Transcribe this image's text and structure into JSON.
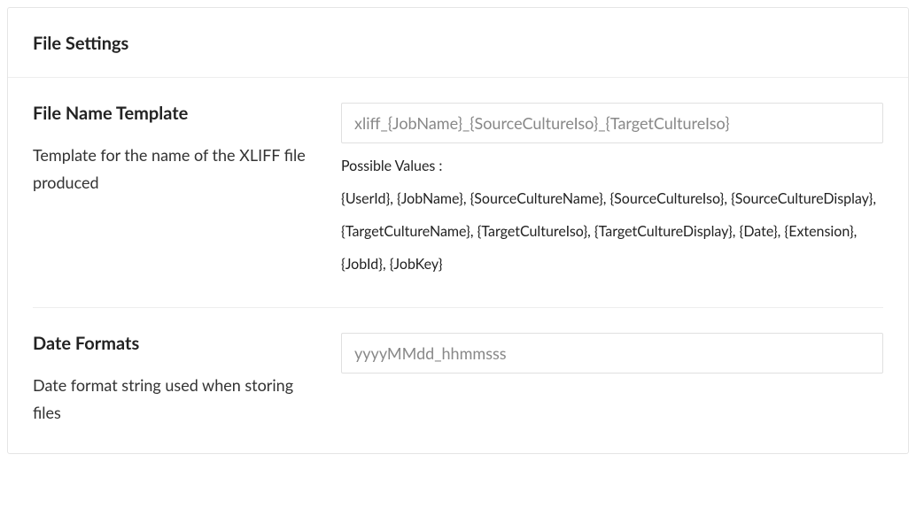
{
  "panel": {
    "title": "File Settings"
  },
  "settings": {
    "fileNameTemplate": {
      "label": "File Name Template",
      "description": "Template for the name of the XLIFF file produced",
      "value": "xliff_{JobName}_{SourceCultureIso}_{TargetCultureIso}",
      "hintLabel": "Possible Values :",
      "hintValues": "{UserId}, {JobName}, {SourceCultureName}, {SourceCultureIso}, {SourceCultureDisplay}, {TargetCultureName}, {TargetCultureIso}, {TargetCultureDisplay}, {Date}, {Extension}, {JobId}, {JobKey}"
    },
    "dateFormats": {
      "label": "Date Formats",
      "description": "Date format string used when storing files",
      "value": "yyyyMMdd_hhmmsss"
    }
  }
}
